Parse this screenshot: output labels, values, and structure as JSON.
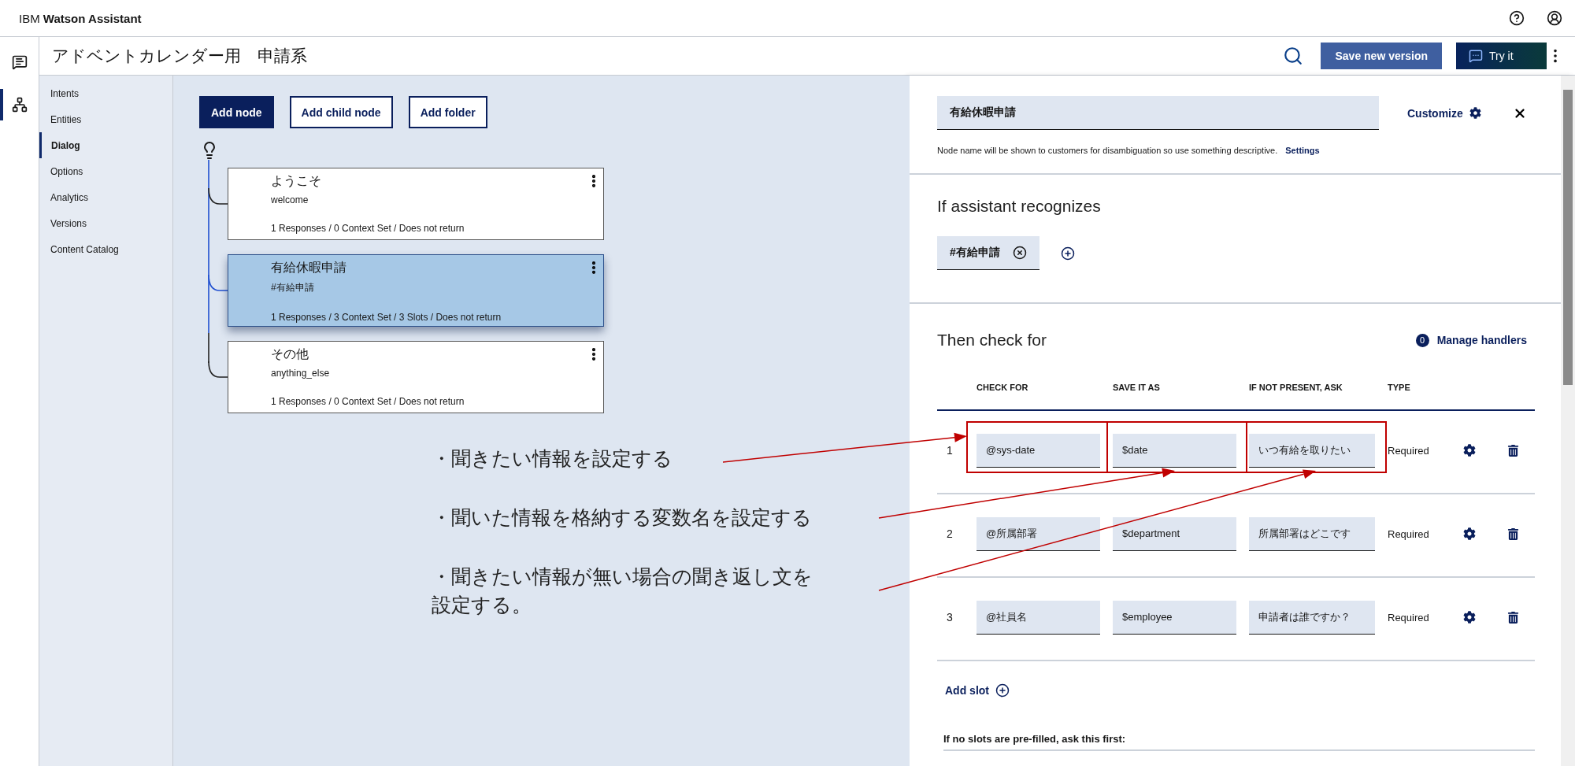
{
  "app_bar": {
    "title": "IBM **Watson Assistant**"
  },
  "rail": [
    {
      "kind": "chat",
      "selected": false
    },
    {
      "kind": "dialog",
      "selected": true
    }
  ],
  "skill_title": "アドベントカレンダー用　申請系",
  "header_actions": {
    "save": "Save new version",
    "try": "Try it"
  },
  "sidebar": [
    {
      "label": "Intents",
      "selected": false
    },
    {
      "label": "Entities",
      "selected": false
    },
    {
      "label": "Dialog",
      "selected": true
    },
    {
      "label": "Options",
      "selected": false
    },
    {
      "label": "Analytics",
      "selected": false
    },
    {
      "label": "Versions",
      "selected": false
    },
    {
      "label": "Content Catalog",
      "selected": false
    }
  ],
  "toolbar": [
    {
      "label": "Add node",
      "kind": "primary"
    },
    {
      "label": "Add child node",
      "kind": "secondary"
    },
    {
      "label": "Add folder",
      "kind": "secondary"
    }
  ],
  "nodes": [
    {
      "title": "ようこそ",
      "condition": "welcome",
      "summary": "1 Responses / 0 Context Set / Does not return",
      "selected": false
    },
    {
      "title": "有給休暇申請",
      "condition": "#有給申請",
      "summary": "1 Responses / 3 Context Set / 3 Slots / Does not return",
      "selected": true
    },
    {
      "title": "その他",
      "condition": "anything_else",
      "summary": "1 Responses / 0 Context Set / Does not return",
      "selected": false
    }
  ],
  "annotations": [
    "・聞きたい情報を設定する",
    "・聞いた情報を格納する変数名を設定する",
    "・聞きたい情報が無い場合の聞き返し文を設定する。"
  ],
  "editor": {
    "node_name": "有給休暇申請",
    "customize": "Customize",
    "hint": "Node name will be shown to customers for disambiguation so use something descriptive.",
    "settings_link": "Settings",
    "recognizes_title": "If assistant recognizes",
    "conditions": [
      "#有給申請"
    ],
    "slots_title": "Then check for",
    "handlers_count": "0",
    "handlers_link": "Manage handlers",
    "columns": [
      "CHECK FOR",
      "SAVE IT AS",
      "IF NOT PRESENT, ASK",
      "TYPE"
    ],
    "slots": [
      {
        "number": "1",
        "check_for": "@sys-date",
        "save_as": "$date",
        "ask": "いつ有給を取りたい",
        "type": "Required"
      },
      {
        "number": "2",
        "check_for": "@所属部署",
        "save_as": "$department",
        "ask": "所属部署はどこです",
        "type": "Required"
      },
      {
        "number": "3",
        "check_for": "@社員名",
        "save_as": "$employee",
        "ask": "申請者は誰ですか？",
        "type": "Required"
      }
    ],
    "add_slot": "Add slot",
    "prefill_label": "If no slots are pre-filled, ask this first:"
  }
}
